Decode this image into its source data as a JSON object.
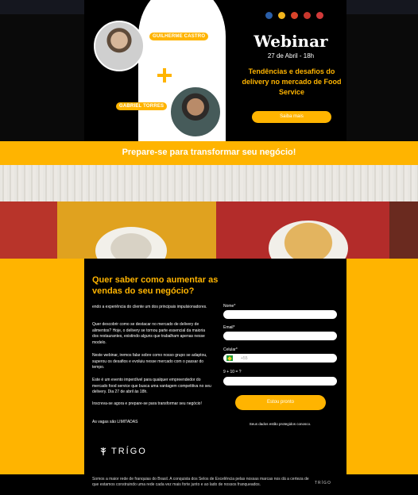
{
  "hero": {
    "speaker1": "GUILHERME CASTRO",
    "speaker2": "GABRIEL TORRES",
    "title": "Webinar",
    "date": "27 de Abril - 18h",
    "subtitle": "Tendências e desafios do delivery no mercado de Food Service",
    "cta": "Saiba mais",
    "icons": [
      "partner-logo-1",
      "partner-logo-2",
      "partner-logo-3",
      "partner-logo-4",
      "partner-logo-5"
    ]
  },
  "band": {
    "text": "Prepare-se para transformar seu negócio!"
  },
  "form": {
    "heading": "Quer saber como aumentar as vendas do seu negócio?",
    "paragraphs": [
      "endo a experiência do cliente um dos principais impulsionadores.",
      "Quer descobrir como se destacar no mercado de delivery de alimentos? Hoje, o delivery se tornou parte essencial da maioria dos restaurantes, existindo alguns que trabalham apenas nesse modelo.",
      "Neste webinar, iremos falar sobre como nosso grupo se adaptou, superou os desafios e evoluiu nesse mercado com o passar do tempo.",
      "Este é um evento imperdível para qualquer empreendedor do mercado food service que busca uma vantagem competitiva no seu delivery. Dia 27 de abril às 18h.",
      "Inscreva-se agora e prepare-se para transformar seu negócio!",
      "As vagas são LIMITADAS"
    ],
    "name_label": "Nome*",
    "email_label": "Email*",
    "phone_label": "Celular*",
    "phone_placeholder": "+55",
    "captcha_label": "9 + 10 = ?",
    "submit": "Estou pronto",
    "privacy": "Seus dados estão protegidos conosco."
  },
  "logo": "TRÍGO",
  "footer": {
    "text": "Somos a maior rede de franquias do Brasil. A conquista dos Selos de Excelência pelas nossas marcas nos dá a certeza de que estamos construindo uma rede cada vez mais forte junto e ao lado de nossos franqueados.",
    "logo": "TRÍGO"
  },
  "colors": {
    "accent": "#ffb400",
    "background": "#000000"
  }
}
